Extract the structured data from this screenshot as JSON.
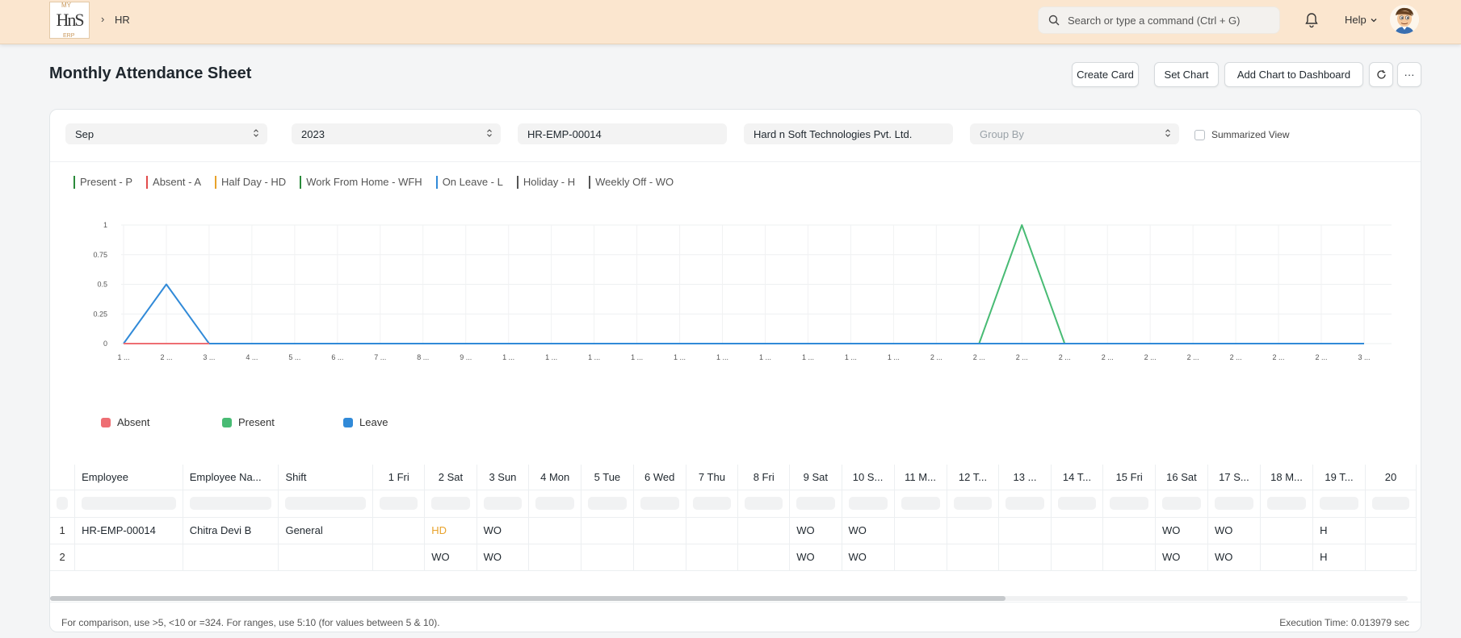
{
  "nav": {
    "logo_text": "HnS",
    "logo_top": "MY",
    "logo_bottom": "ERP",
    "breadcrumb": "HR",
    "search_placeholder": "Search or type a command (Ctrl + G)",
    "help_label": "Help"
  },
  "page": {
    "title": "Monthly Attendance Sheet",
    "buttons": {
      "create_card": "Create Card",
      "set_chart": "Set Chart",
      "add_to_dashboard": "Add Chart to Dashboard",
      "more": "···"
    }
  },
  "filters": {
    "month": "Sep",
    "year": "2023",
    "employee": "HR-EMP-00014",
    "company": "Hard n Soft Technologies Pvt. Ltd.",
    "group_by_placeholder": "Group By",
    "summarized_label": "Summarized View"
  },
  "status_legend": [
    {
      "label": "Present - P",
      "color": "#2a8a3a"
    },
    {
      "label": "Absent - A",
      "color": "#e24c4c"
    },
    {
      "label": "Half Day - HD",
      "color": "#e8a22b"
    },
    {
      "label": "Work From Home - WFH",
      "color": "#2a8a3a"
    },
    {
      "label": "On Leave - L",
      "color": "#318ad8"
    },
    {
      "label": "Holiday - H",
      "color": "#555555"
    },
    {
      "label": "Weekly Off - WO",
      "color": "#555555"
    }
  ],
  "chart_data": {
    "type": "line",
    "x": [
      "1 ...",
      "2 ...",
      "3 ...",
      "4 ...",
      "5 ...",
      "6 ...",
      "7 ...",
      "8 ...",
      "9 ...",
      "1 ...",
      "1 ...",
      "1 ...",
      "1 ...",
      "1 ...",
      "1 ...",
      "1 ...",
      "1 ...",
      "1 ...",
      "1 ...",
      "2 ...",
      "2 ...",
      "2 ...",
      "2 ...",
      "2 ...",
      "2 ...",
      "2 ...",
      "2 ...",
      "2 ...",
      "2 ...",
      "3 ..."
    ],
    "yticks": [
      "0",
      "0.25",
      "0.5",
      "0.75",
      "1"
    ],
    "ylim": [
      0,
      1
    ],
    "series": [
      {
        "name": "Absent",
        "color": "#ee6e73",
        "values": [
          0,
          0,
          0,
          0,
          0,
          0,
          0,
          0,
          0,
          0,
          0,
          0,
          0,
          0,
          0,
          0,
          0,
          0,
          0,
          0,
          0,
          0,
          0,
          0,
          0,
          0,
          0,
          0,
          0,
          0
        ]
      },
      {
        "name": "Present",
        "color": "#48bb74",
        "values": [
          0,
          0,
          0,
          0,
          0,
          0,
          0,
          0,
          0,
          0,
          0,
          0,
          0,
          0,
          0,
          0,
          0,
          0,
          0,
          0,
          0,
          1,
          0,
          0,
          0,
          0,
          0,
          0,
          0,
          0
        ]
      },
      {
        "name": "Leave",
        "color": "#318ad8",
        "values": [
          0,
          0.5,
          0,
          0,
          0,
          0,
          0,
          0,
          0,
          0,
          0,
          0,
          0,
          0,
          0,
          0,
          0,
          0,
          0,
          0,
          0,
          0,
          0,
          0,
          0,
          0,
          0,
          0,
          0,
          0
        ]
      }
    ]
  },
  "table": {
    "columns": [
      "Employee",
      "Employee Na...",
      "Shift",
      "1 Fri",
      "2 Sat",
      "3 Sun",
      "4 Mon",
      "5 Tue",
      "6 Wed",
      "7 Thu",
      "8 Fri",
      "9 Sat",
      "10 S...",
      "11 M...",
      "12 T...",
      "13 ...",
      "14 T...",
      "15 Fri",
      "16 Sat",
      "17 S...",
      "18 M...",
      "19 T...",
      "20"
    ],
    "rows": [
      [
        "HR-EMP-00014",
        "Chitra Devi B",
        "General",
        "",
        "HD",
        "WO",
        "",
        "",
        "",
        "",
        "",
        "WO",
        "WO",
        "",
        "",
        "",
        "",
        "",
        "WO",
        "WO",
        "",
        "H",
        ""
      ],
      [
        "",
        "",
        "",
        "",
        "WO",
        "WO",
        "",
        "",
        "",
        "",
        "",
        "WO",
        "WO",
        "",
        "",
        "",
        "",
        "",
        "WO",
        "WO",
        "",
        "H",
        ""
      ]
    ],
    "row_numbers": [
      "1",
      "2"
    ]
  },
  "footer": {
    "hint": "For comparison, use >5, <10 or =324. For ranges, use 5:10 (for values between 5 & 10).",
    "execution_time": "Execution Time: 0.013979 sec"
  }
}
